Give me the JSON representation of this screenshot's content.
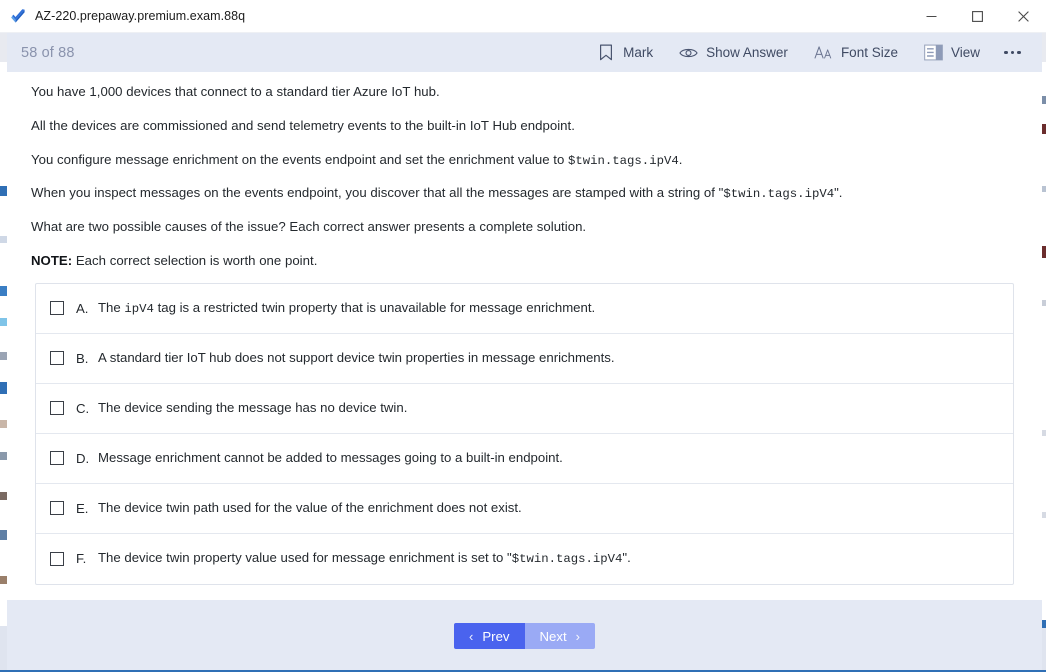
{
  "window": {
    "title": "AZ-220.prepaway.premium.exam.88q",
    "app_icon": "blue-checkmark-icon",
    "controls": {
      "minimize": "minimize-icon",
      "maximize": "maximize-icon",
      "close": "close-icon"
    }
  },
  "toolbar": {
    "page_counter": "58 of 88",
    "buttons": [
      {
        "id": "mark",
        "label": "Mark",
        "icon": "bookmark-icon"
      },
      {
        "id": "show-answer",
        "label": "Show Answer",
        "icon": "eye-icon"
      },
      {
        "id": "font-size",
        "label": "Font Size",
        "icon": "font-size-icon"
      },
      {
        "id": "view",
        "label": "View",
        "icon": "layout-panel-icon"
      },
      {
        "id": "more",
        "label": "",
        "icon": "ellipsis-icon"
      }
    ]
  },
  "question": {
    "paragraphs": [
      {
        "id": "p1",
        "prefix": "You have 1,000 devices that connect to a standard tier Azure IoT hub.",
        "code": "",
        "suffix": ""
      },
      {
        "id": "p2",
        "prefix": "All the devices are commissioned and send telemetry events to the built-in IoT Hub endpoint.",
        "code": "",
        "suffix": ""
      },
      {
        "id": "p3",
        "prefix": "You configure message enrichment on the events endpoint and set the enrichment value to ",
        "code": "$twin.tags.ipV4",
        "suffix": "."
      },
      {
        "id": "p4",
        "prefix": "When you inspect messages on the events endpoint, you discover that all the messages are stamped with a string of \"",
        "code": "$twin.tags.ipV4",
        "suffix": "\"."
      },
      {
        "id": "p5",
        "prefix": "What are two possible causes of the issue? Each correct answer presents a complete solution.",
        "code": "",
        "suffix": ""
      }
    ],
    "note_label": "NOTE:",
    "note_text": " Each correct selection is worth one point.",
    "options": [
      {
        "letter": "A.",
        "prefix": "The ",
        "code": "ipV4",
        "suffix": " tag is a restricted twin property that is unavailable for message enrichment.",
        "checked": false
      },
      {
        "letter": "B.",
        "prefix": "A standard tier IoT hub does not support device twin properties in message enrichments.",
        "code": "",
        "suffix": "",
        "checked": false
      },
      {
        "letter": "C.",
        "prefix": "The device sending the message has no device twin.",
        "code": "",
        "suffix": "",
        "checked": false
      },
      {
        "letter": "D.",
        "prefix": "Message enrichment cannot be added to messages going to a built-in endpoint.",
        "code": "",
        "suffix": "",
        "checked": false
      },
      {
        "letter": "E.",
        "prefix": "The device twin path used for the value of the enrichment does not exist.",
        "code": "",
        "suffix": "",
        "checked": false
      },
      {
        "letter": "F.",
        "prefix": "The device twin property value used for message enrichment is set to \"",
        "code": "$twin.tags.ipV4",
        "suffix": "\".",
        "checked": false
      }
    ]
  },
  "footer": {
    "prev_label": "Prev",
    "next_label": "Next",
    "prev_chevron": "‹",
    "next_chevron": "›"
  },
  "colors": {
    "toolbar_bg": "#e4e9f4",
    "prev_button": "#4a63ee",
    "next_button": "#9aaaf5",
    "counter_text": "#8a93ad",
    "body_text": "#24292e",
    "bottom_rule": "#2f6fb5"
  }
}
